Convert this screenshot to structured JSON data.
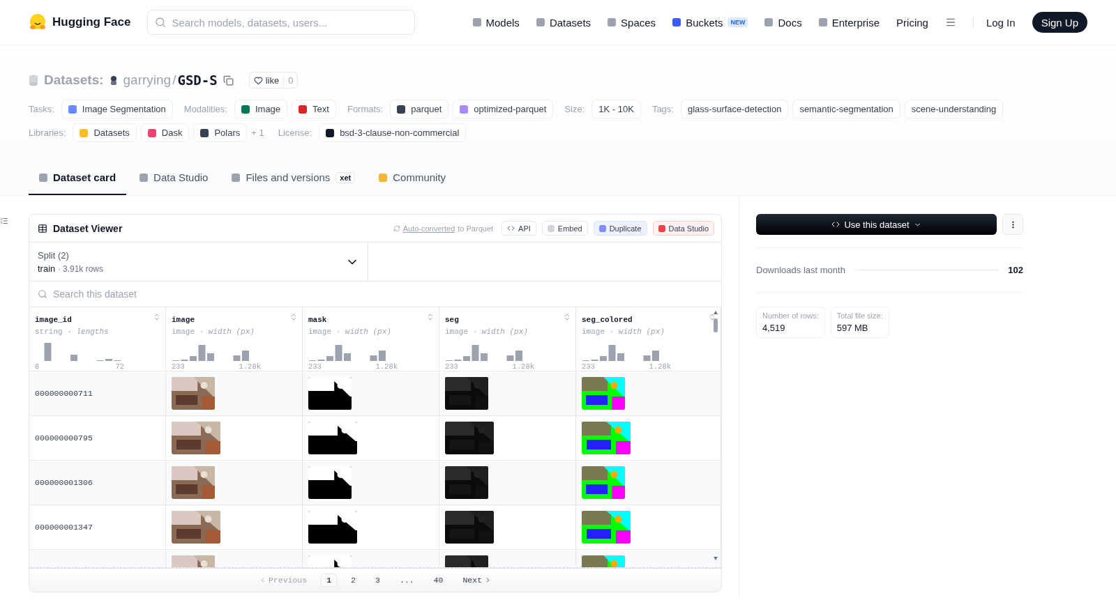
{
  "header": {
    "brand": "Hugging Face",
    "search": {
      "placeholder": "Search models, datasets, users..."
    },
    "nav": [
      {
        "label": "Models",
        "color": "#9ca3af"
      },
      {
        "label": "Datasets",
        "color": "#9ca3af"
      },
      {
        "label": "Spaces",
        "color": "#9ca3af"
      },
      {
        "label": "Buckets",
        "color": "#3b5bfd",
        "badge": "NEW"
      },
      {
        "label": "Docs",
        "color": "#9ca3af"
      },
      {
        "label": "Enterprise",
        "color": "#9ca3af"
      },
      {
        "label": "Pricing"
      }
    ],
    "login": "Log In",
    "signup": "Sign Up"
  },
  "repo": {
    "prefix": "Datasets:",
    "owner": "garrying",
    "separator": "/",
    "name": "GSD-S",
    "like": "like",
    "likes": "0"
  },
  "tag_rows": [
    {
      "groups": [
        {
          "label": "Tasks:",
          "tags": [
            {
              "text": "Image Segmentation",
              "color": "#6b8afd"
            }
          ]
        },
        {
          "label": "Modalities:",
          "tags": [
            {
              "text": "Image",
              "color": "#047857"
            },
            {
              "text": "Text",
              "color": "#dc2626"
            }
          ]
        },
        {
          "label": "Formats:",
          "tags": [
            {
              "text": "parquet",
              "color": "#374151"
            },
            {
              "text": "optimized-parquet",
              "color": "#a78bfa"
            }
          ]
        },
        {
          "label": "Size:",
          "tags": [
            {
              "text": "1K - 10K"
            }
          ]
        },
        {
          "label": "Tags:",
          "tags": [
            {
              "text": "glass-surface-detection"
            },
            {
              "text": "semantic-segmentation"
            },
            {
              "text": "scene-understanding"
            }
          ]
        }
      ]
    },
    {
      "groups": [
        {
          "label": "Libraries:",
          "tags": [
            {
              "text": "Datasets",
              "color": "#fbbf24"
            },
            {
              "text": "Dask",
              "color": "#ef4470"
            },
            {
              "text": "Polars",
              "color": "#374151"
            }
          ],
          "more": "+ 1"
        },
        {
          "label": "License:",
          "tags": [
            {
              "text": "bsd-3-clause-non-commercial",
              "color": "#111827"
            }
          ]
        }
      ]
    }
  ],
  "tabs": [
    {
      "label": "Dataset card",
      "selected": true,
      "color": "#9ca3af"
    },
    {
      "label": "Data Studio",
      "selected": false,
      "color": "#9ca3af"
    },
    {
      "label": "Files and versions",
      "selected": false,
      "color": "#9ca3af",
      "badge": "xet"
    },
    {
      "label": "Community",
      "selected": false,
      "color": "#f5b73b"
    }
  ],
  "viewer": {
    "title": "Dataset Viewer",
    "link": "Auto-converted",
    "link_rest": "to Parquet",
    "actions": [
      {
        "label": "API",
        "kind": "plain"
      },
      {
        "label": "Embed",
        "kind": "plain"
      },
      {
        "label": "Duplicate",
        "kind": "accent"
      },
      {
        "label": "Data Studio",
        "kind": "danger"
      }
    ],
    "split": {
      "label": "Split (2)",
      "value": "train",
      "separator": "·",
      "rows": "3.91k rows"
    },
    "search": {
      "placeholder": "Search this dataset"
    },
    "columns": [
      {
        "name": "image_id",
        "type": "string",
        "separator": "·",
        "detail": "lengths",
        "min": "8",
        "max": "72"
      },
      {
        "name": "image",
        "type": "image",
        "separator": "·",
        "detail": "width (px)",
        "min": "233",
        "max": "1.28k"
      },
      {
        "name": "mask",
        "type": "image",
        "separator": "·",
        "detail": "width (px)",
        "min": "233",
        "max": "1.28k"
      },
      {
        "name": "seg",
        "type": "image",
        "separator": "·",
        "detail": "width (px)",
        "min": "233",
        "max": "1.28k"
      },
      {
        "name": "seg_colored",
        "type": "image",
        "separator": "·",
        "detail": "width (px)",
        "min": "233",
        "max": "1.28k"
      }
    ],
    "rows": [
      {
        "id": "000000000711"
      },
      {
        "id": "000000000795"
      },
      {
        "id": "000000001306"
      },
      {
        "id": "000000001347"
      },
      {
        "partial": true
      }
    ],
    "pagination": {
      "previous": "Previous",
      "pages": [
        {
          "label": "1",
          "selected": true
        },
        {
          "label": "2",
          "selected": false
        },
        {
          "label": "3",
          "selected": false
        },
        {
          "label": "...",
          "selected": false
        },
        {
          "label": "40",
          "selected": false
        }
      ],
      "next": "Next"
    }
  },
  "sidebar": {
    "use_button": "Use this dataset",
    "downloads_label": "Downloads last month",
    "downloads": "102",
    "stats": [
      {
        "label": "Number of rows:",
        "value": "4,519"
      },
      {
        "label": "Total file size:",
        "value": "597 MB"
      }
    ]
  }
}
